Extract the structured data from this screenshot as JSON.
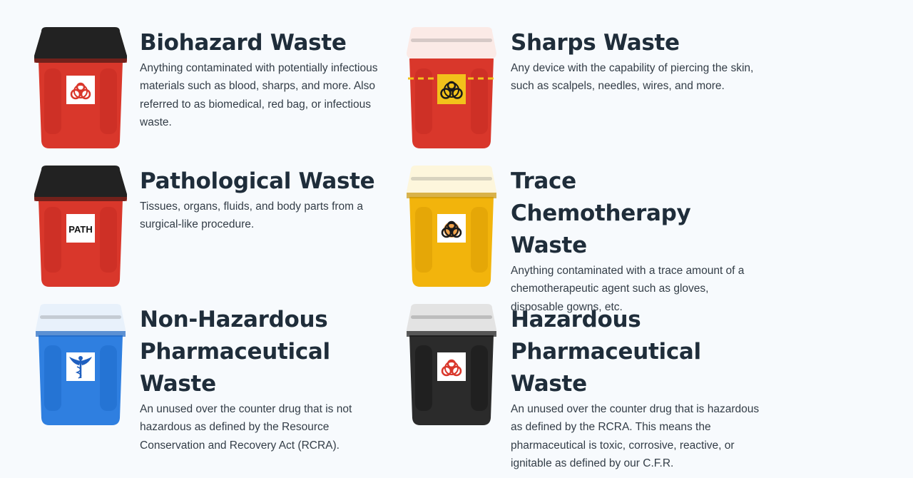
{
  "cards": [
    {
      "title": "Biohazard Waste",
      "description": "Anything contaminated with potentially infectious materials such as blood, sharps, and more. Also referred to as biomedical, red bag, or infectious waste.",
      "lid_color": "#222222",
      "body_color": "#d9372b",
      "icon": "biohazard-icon"
    },
    {
      "title": "Sharps Waste",
      "description": "Any device with the capability of piercing the skin, such as scalpels, needles, wires, and more.",
      "lid_color": "#fbeae6",
      "body_color": "#d9372b",
      "icon": "biohazard-icon"
    },
    {
      "title": "Pathological Waste",
      "description": "Tissues, organs, fluids, and body parts from a surgical-like procedure.",
      "lid_color": "#222222",
      "body_color": "#d9372b",
      "icon": "path-label",
      "label_text": "PATH"
    },
    {
      "title": "Trace Chemotherapy Waste",
      "description": "Anything contaminated with a trace amount of a chemotherapeutic agent such as gloves, disposable gowns, etc.",
      "lid_color": "#fdf6dc",
      "body_color": "#f2b40c",
      "icon": "biohazard-icon"
    },
    {
      "title": "Non-Hazardous Pharmaceutical Waste",
      "description": "An unused over the counter drug that is not hazardous as defined by the Resource Conservation and Recovery Act (RCRA).",
      "lid_color": "#e8f1fb",
      "body_color": "#2f7fe0",
      "icon": "caduceus-icon"
    },
    {
      "title": "Hazardous Pharmaceutical Waste",
      "description": "An unused over the counter drug that is hazardous as defined by the RCRA. This means the pharmaceutical is toxic, corrosive, reactive, or ignitable as defined by our C.F.R.",
      "lid_color": "#e3e3e3",
      "body_color": "#2b2b2b",
      "icon": "biohazard-icon"
    }
  ]
}
